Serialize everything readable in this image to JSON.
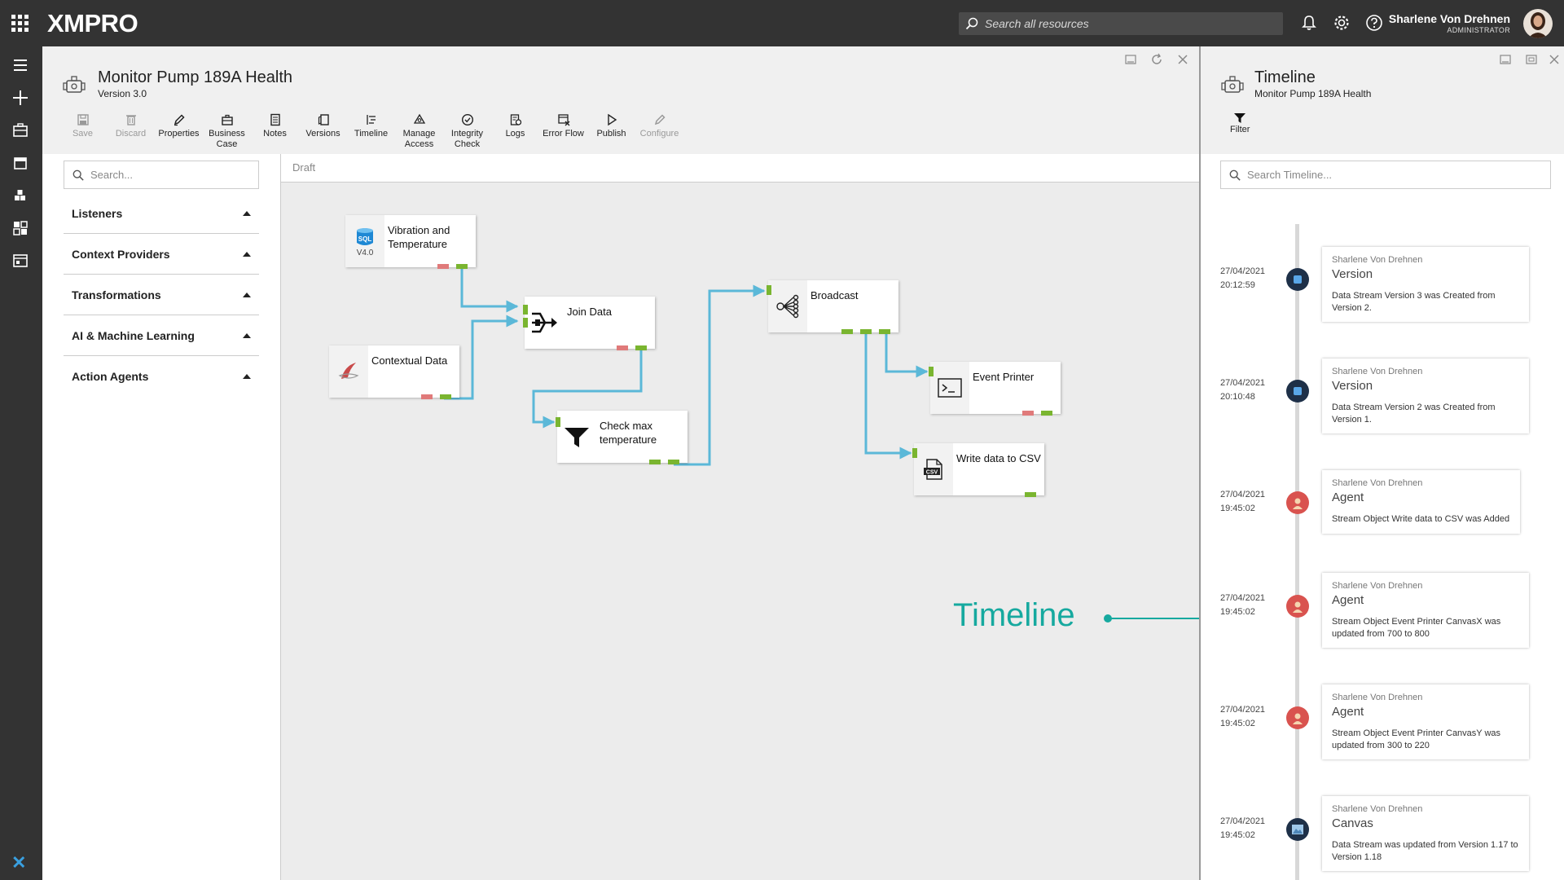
{
  "topbar": {
    "logo": "XMPRO",
    "search_placeholder": "Search all resources",
    "user_name": "Sharlene Von Drehnen",
    "user_role": "ADMINISTRATOR"
  },
  "datastream": {
    "title": "Monitor Pump 189A Health",
    "version": "Version 3.0"
  },
  "toolbar": [
    {
      "label": "Save",
      "icon": "save-icon",
      "disabled": true
    },
    {
      "label": "Discard",
      "icon": "trash-icon",
      "disabled": true
    },
    {
      "label": "Properties",
      "icon": "pencil-icon",
      "disabled": false
    },
    {
      "label": "Business Case",
      "icon": "briefcase-icon",
      "disabled": false
    },
    {
      "label": "Notes",
      "icon": "notes-icon",
      "disabled": false
    },
    {
      "label": "Versions",
      "icon": "versions-icon",
      "disabled": false
    },
    {
      "label": "Timeline",
      "icon": "timeline-icon",
      "disabled": false
    },
    {
      "label": "Manage Access",
      "icon": "access-icon",
      "disabled": false
    },
    {
      "label": "Integrity Check",
      "icon": "check-circle-icon",
      "disabled": false
    },
    {
      "label": "Logs",
      "icon": "logs-icon",
      "disabled": false
    },
    {
      "label": "Error Flow",
      "icon": "error-flow-icon",
      "disabled": false
    },
    {
      "label": "Publish",
      "icon": "play-icon",
      "disabled": false
    },
    {
      "label": "Configure",
      "icon": "pencil-icon",
      "disabled": true
    }
  ],
  "palette": {
    "search_placeholder": "Search...",
    "categories": [
      "Listeners",
      "Context Providers",
      "Transformations",
      "AI & Machine Learning",
      "Action Agents"
    ]
  },
  "canvas": {
    "status": "Draft",
    "nodes": {
      "vibration": {
        "label": "Vibration and Temperature",
        "version": "V4.0",
        "icon": "sql-icon"
      },
      "contextual": {
        "label": "Contextual Data",
        "icon": "sql-server-icon"
      },
      "join": {
        "label": "Join Data",
        "icon": "join-icon"
      },
      "check": {
        "label": "Check max temperature",
        "icon": "filter-icon"
      },
      "broadcast": {
        "label": "Broadcast",
        "icon": "broadcast-icon"
      },
      "printer": {
        "label": "Event Printer",
        "icon": "terminal-icon"
      },
      "csv": {
        "label": "Write data to CSV",
        "icon": "csv-icon"
      }
    }
  },
  "annotation": {
    "label": "Timeline"
  },
  "timeline_panel": {
    "title": "Timeline",
    "subtitle": "Monitor Pump 189A Health",
    "filter_label": "Filter",
    "search_placeholder": "Search Timeline...",
    "entries": [
      {
        "date": "27/04/2021",
        "time": "20:12:59",
        "user": "Sharlene Von Drehnen",
        "type": "Version",
        "desc": "Data Stream Version 3 was Created from Version 2.",
        "icon": "version-icon"
      },
      {
        "date": "27/04/2021",
        "time": "20:10:48",
        "user": "Sharlene Von Drehnen",
        "type": "Version",
        "desc": "Data Stream Version 2 was Created from Version 1.",
        "icon": "version-icon"
      },
      {
        "date": "27/04/2021",
        "time": "19:45:02",
        "user": "Sharlene Von Drehnen",
        "type": "Agent",
        "desc": "Stream Object Write data to CSV was Added",
        "icon": "agent-icon"
      },
      {
        "date": "27/04/2021",
        "time": "19:45:02",
        "user": "Sharlene Von Drehnen",
        "type": "Agent",
        "desc": "Stream Object Event Printer CanvasX was updated from 700 to 800",
        "icon": "agent-icon"
      },
      {
        "date": "27/04/2021",
        "time": "19:45:02",
        "user": "Sharlene Von Drehnen",
        "type": "Agent",
        "desc": "Stream Object Event Printer CanvasY was updated from 300 to 220",
        "icon": "agent-icon"
      },
      {
        "date": "27/04/2021",
        "time": "19:45:02",
        "user": "Sharlene Von Drehnen",
        "type": "Canvas",
        "desc": "Data Stream was updated from Version 1.17 to Version 1.18",
        "icon": "canvas-icon"
      }
    ]
  },
  "colors": {
    "topbar": "#333333",
    "accent": "#16a99f",
    "connector": "#5bb8d8",
    "port_green": "#7ab530",
    "port_red": "#e07a7a"
  }
}
